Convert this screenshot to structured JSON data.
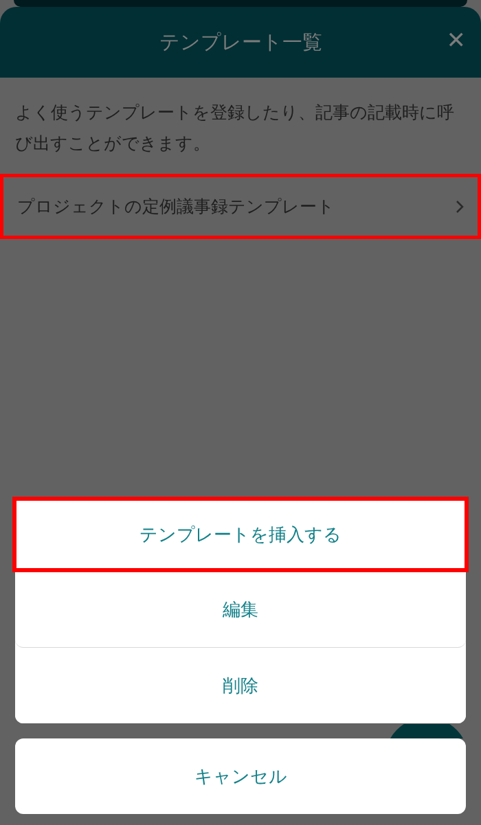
{
  "window": {
    "title": "テンプレート一覧",
    "close": "✕"
  },
  "description": "よく使うテンプレートを登録したり、記事の記載時に呼び出すことができます。",
  "templates": [
    {
      "name": "プロジェクトの定例議事録テンプレート",
      "highlighted": true
    }
  ],
  "action_sheet": {
    "actions": [
      {
        "label": "テンプレートを挿入する",
        "highlighted": true
      },
      {
        "label": "編集",
        "highlighted": false
      },
      {
        "label": "削除",
        "highlighted": false
      }
    ],
    "cancel": "キャンセル"
  }
}
